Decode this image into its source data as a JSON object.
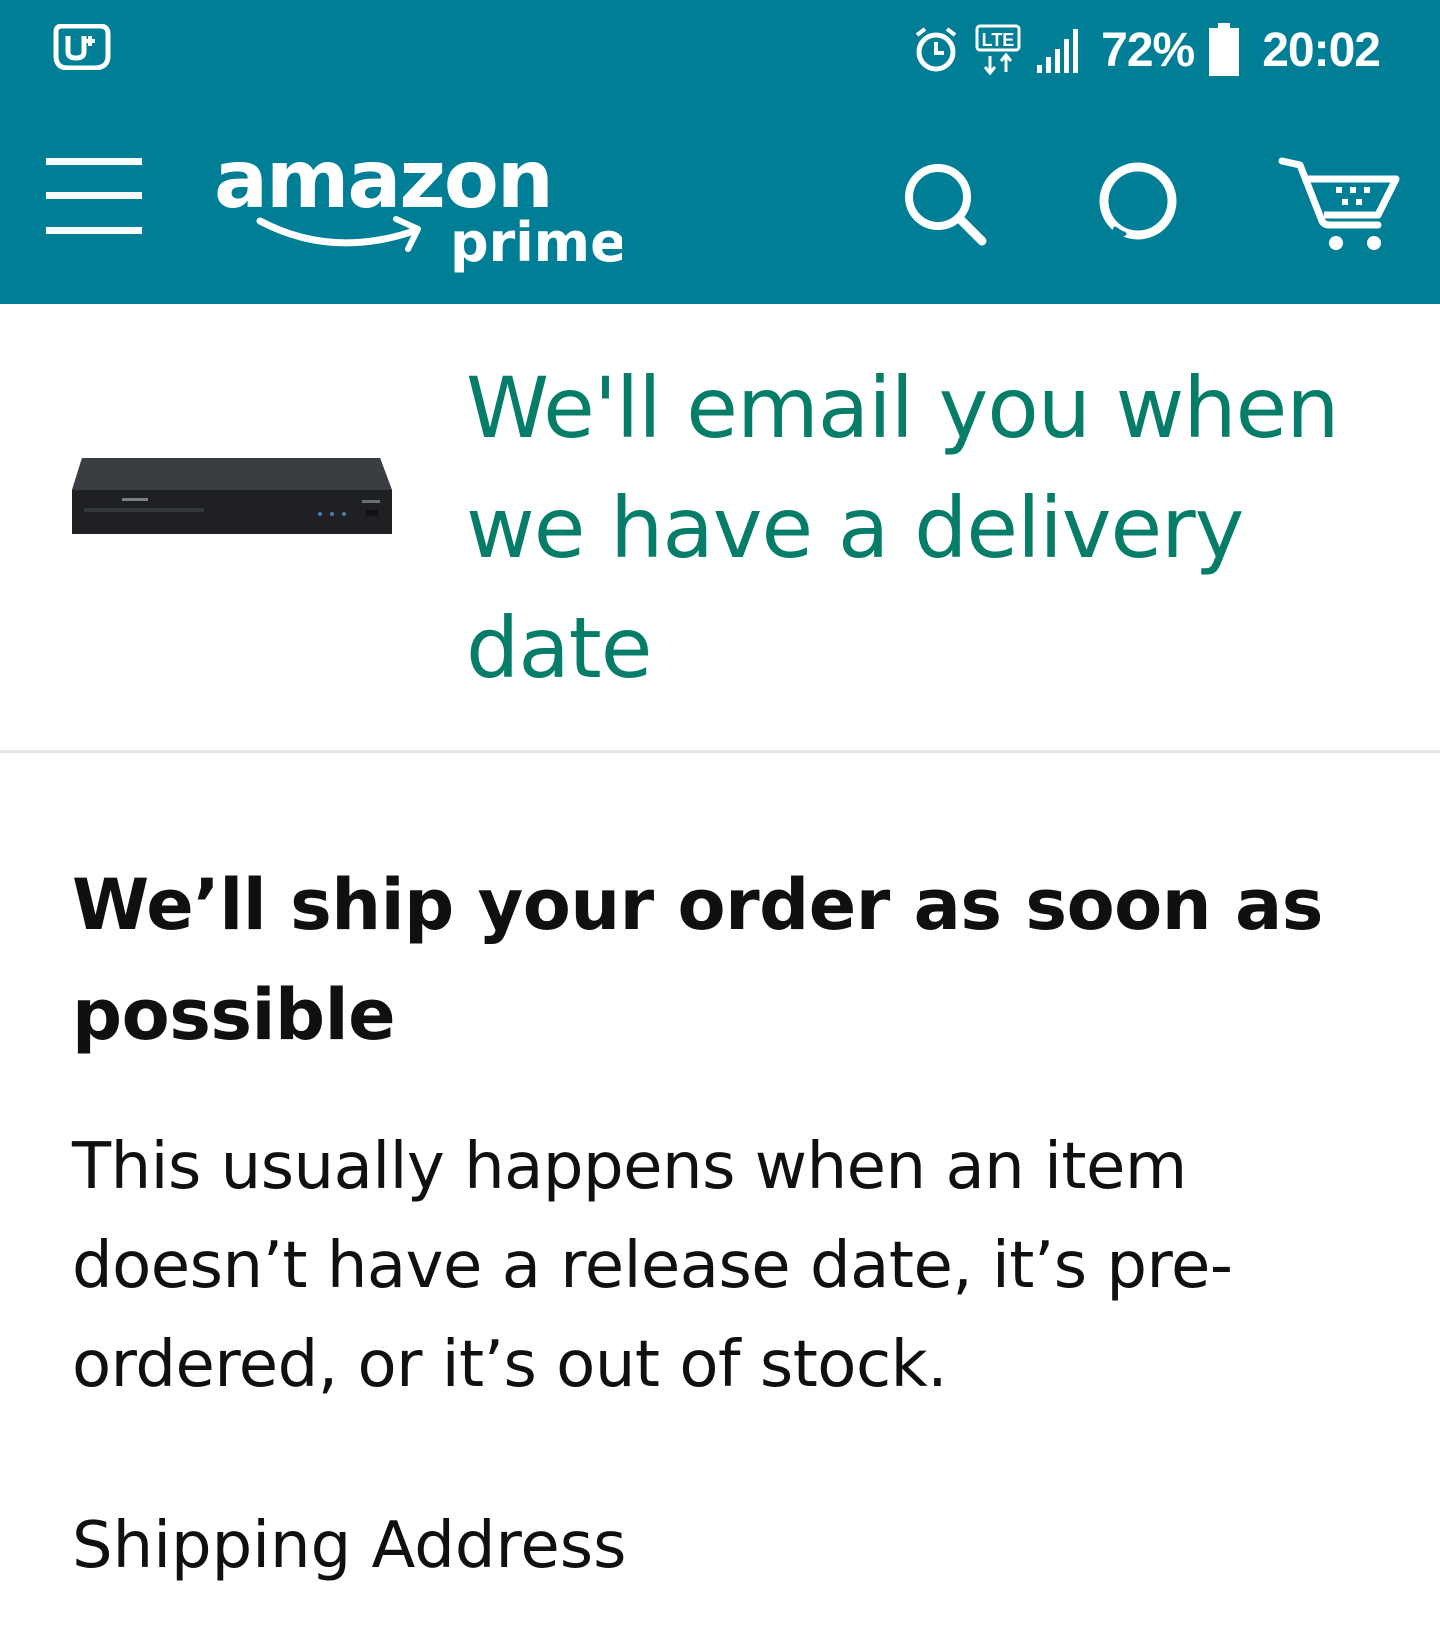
{
  "status_bar": {
    "left_icon": "u-plus-app-icon",
    "icons": [
      "alarm-icon",
      "lte-data-icon",
      "signal-icon",
      "battery-icon"
    ],
    "lte_label": "LTE",
    "battery_percent": "72%",
    "time": "20:02"
  },
  "app_bar": {
    "menu_icon": "hamburger-menu-icon",
    "logo_word": "amazon",
    "logo_sub": "prime",
    "search_icon": "search-icon",
    "alexa_icon": "alexa-icon",
    "cart_icon": "cart-icon",
    "background": "#007e96"
  },
  "hero": {
    "product_image": "blu-ray-player-image",
    "title": "We'll email you when we have a delivery date",
    "title_color": "#067d68"
  },
  "section": {
    "title": "We’ll ship your order as soon as possible",
    "body": "This usually happens when an item doesn’t have a release date, it’s pre-ordered, or it’s out of stock.",
    "shipping_label": "Shipping Address"
  }
}
